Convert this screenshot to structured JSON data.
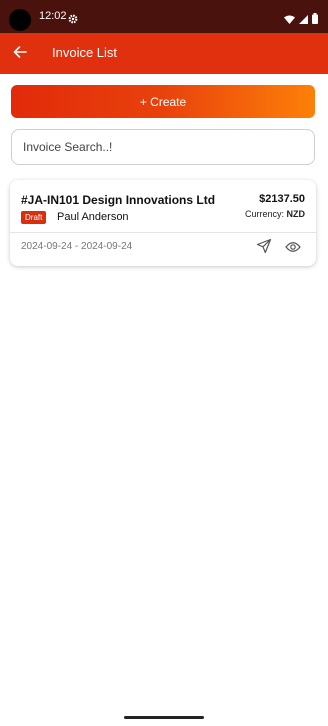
{
  "status_bar": {
    "time": "12:02"
  },
  "app_bar": {
    "title": "Invoice List"
  },
  "actions": {
    "create_label": "+ Create"
  },
  "search": {
    "placeholder": "Invoice Search..!"
  },
  "invoices": [
    {
      "title": "#JA-IN101 Design Innovations Ltd",
      "amount": "$2137.50",
      "status": "Draft",
      "customer": "Paul Anderson",
      "currency_label": "Currency:",
      "currency": "NZD",
      "date_range": "2024-09-24 - 2024-09-24"
    }
  ],
  "colors": {
    "status_bar": "#4a120c",
    "app_bar": "#e0300e",
    "gradient_start": "#e22a0a",
    "gradient_end": "#fd8008",
    "draft_badge": "#d8300e"
  },
  "icons": [
    "gear-icon",
    "wifi-icon",
    "signal-icon",
    "battery-icon",
    "back-arrow-icon",
    "send-icon",
    "eye-icon"
  ]
}
